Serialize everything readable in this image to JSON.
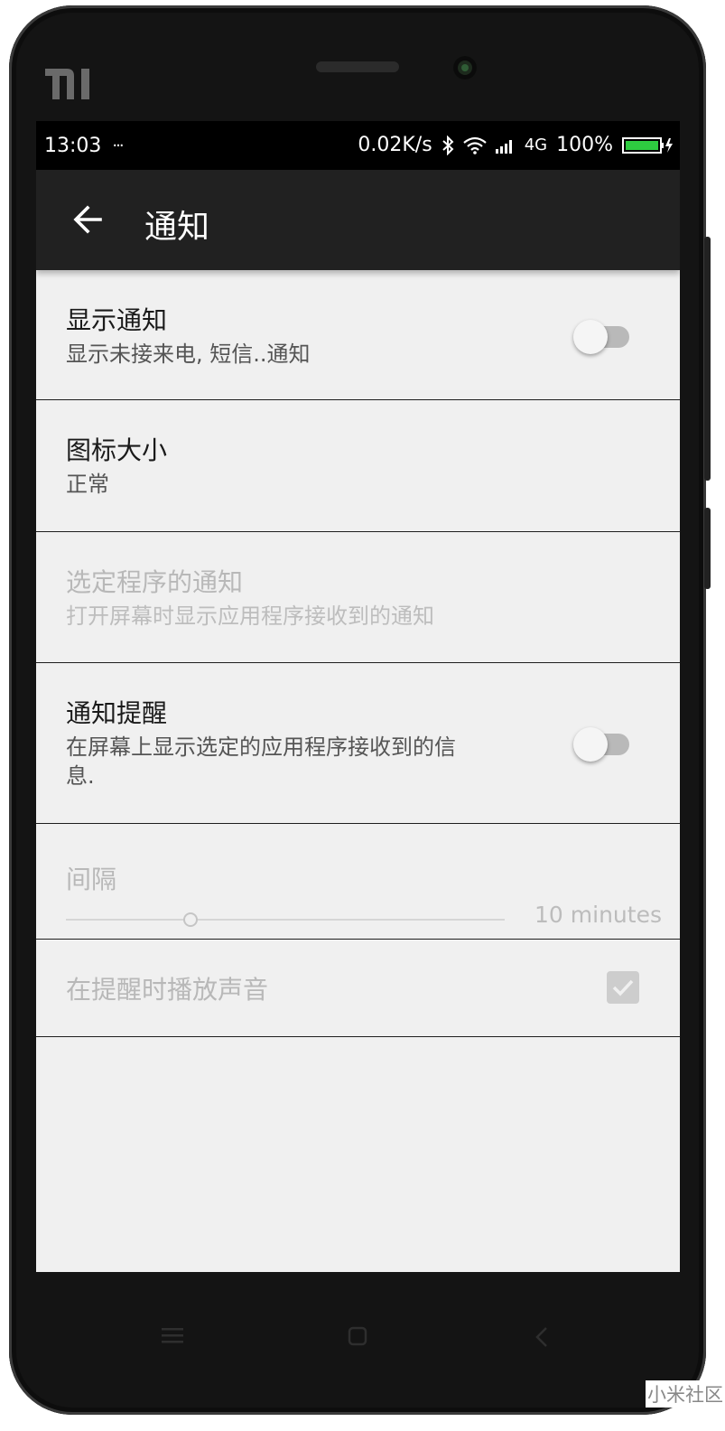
{
  "status_bar": {
    "time": "13:03",
    "dots": "···",
    "net_speed": "0.02K/s",
    "network_type": "4G",
    "battery": "100%",
    "icons": [
      "bluetooth-icon",
      "wifi-icon",
      "signal-icon",
      "battery-icon"
    ]
  },
  "toolbar": {
    "title": "通知",
    "back_icon": "arrow-left-icon"
  },
  "settings": {
    "show_notifications": {
      "title": "显示通知",
      "summary": "显示未接来电, 短信..通知",
      "checked": false
    },
    "icon_size": {
      "title": "图标大小",
      "summary": "正常"
    },
    "selected_apps": {
      "title": "选定程序的通知",
      "summary": "打开屏幕时显示应用程序接收到的通知",
      "enabled": false
    },
    "reminder": {
      "title": "通知提醒",
      "summary_line1": "在屏幕上显示选定的应用程序接收到的信",
      "summary_line2": "息.",
      "checked": false
    },
    "interval": {
      "title": "间隔",
      "value": "10 minutes",
      "enabled": false
    },
    "play_sound": {
      "title": "在提醒时播放声音",
      "checked": true,
      "enabled": false
    }
  },
  "nav_bar": {
    "buttons": [
      "menu-icon",
      "home-icon",
      "back-icon"
    ]
  },
  "watermark": "小米社区",
  "colors": {
    "toolbar": "#212121",
    "background": "#f0f0f0",
    "status_bar": "#000000",
    "battery": "#2ecc40"
  }
}
